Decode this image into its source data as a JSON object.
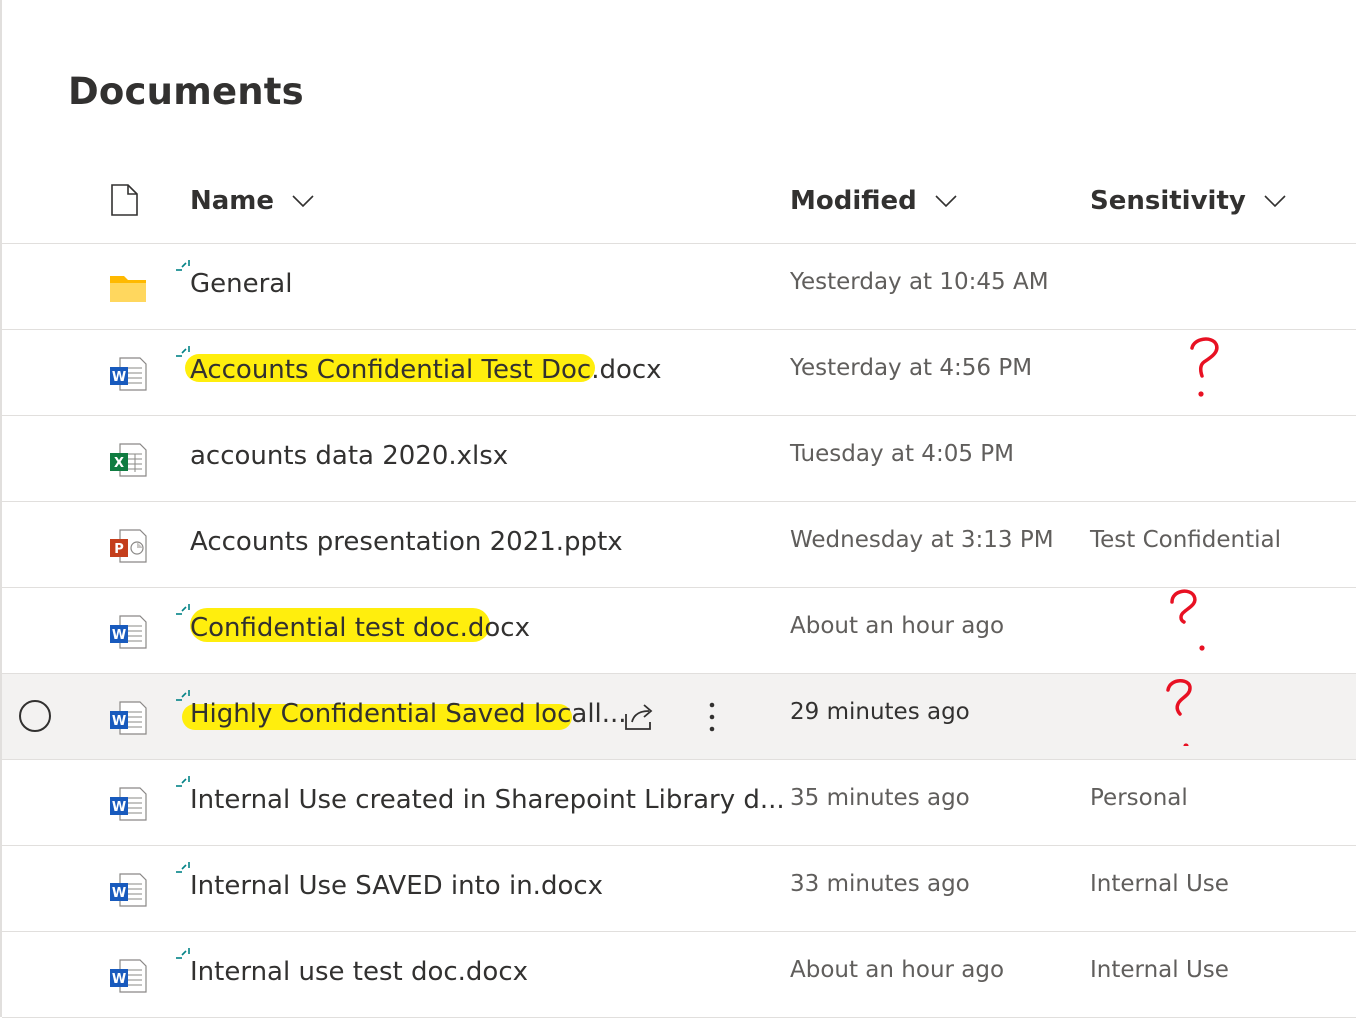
{
  "page": {
    "title": "Documents"
  },
  "columns": {
    "filetype_icon": "document-icon",
    "name": "Name",
    "modified": "Modified",
    "sensitivity": "Sensitivity"
  },
  "rows": [
    {
      "name": "General",
      "modified": "Yesterday at 10:45 AM",
      "sensitivity": "",
      "type": "folder",
      "synced": true
    },
    {
      "name": "Accounts Confidential Test Doc.docx",
      "modified": "Yesterday at 4:56 PM",
      "sensitivity": "",
      "type": "word",
      "synced": true,
      "highlighted": true
    },
    {
      "name": "accounts data 2020.xlsx",
      "modified": "Tuesday at 4:05 PM",
      "sensitivity": "",
      "type": "excel",
      "synced": false
    },
    {
      "name": "Accounts presentation 2021.pptx",
      "modified": "Wednesday at 3:13 PM",
      "sensitivity": "Test Confidential",
      "type": "powerpoint",
      "synced": false
    },
    {
      "name": "Confidential test doc.docx",
      "modified": "About an hour ago",
      "sensitivity": "",
      "type": "word",
      "synced": true,
      "highlighted": true
    },
    {
      "name": "Highly Confidential Saved locall...",
      "modified": "29 minutes ago",
      "sensitivity": "",
      "type": "word",
      "synced": true,
      "highlighted": true,
      "selected": true
    },
    {
      "name": "Internal Use created in Sharepoint Library d...",
      "modified": "35 minutes ago",
      "sensitivity": "Personal",
      "type": "word",
      "synced": true
    },
    {
      "name": "Internal Use SAVED into in.docx",
      "modified": "33 minutes ago",
      "sensitivity": "Internal Use",
      "type": "word",
      "synced": true
    },
    {
      "name": "Internal use test doc.docx",
      "modified": "About an hour ago",
      "sensitivity": "Internal Use",
      "type": "word",
      "synced": true
    }
  ],
  "colors": {
    "highlight": "#ffed00",
    "annotation": "#e81123",
    "word": "#185abd",
    "excel": "#107c41",
    "powerpoint": "#c43e1c",
    "folder": "#ffb900",
    "sync": "#038387"
  }
}
